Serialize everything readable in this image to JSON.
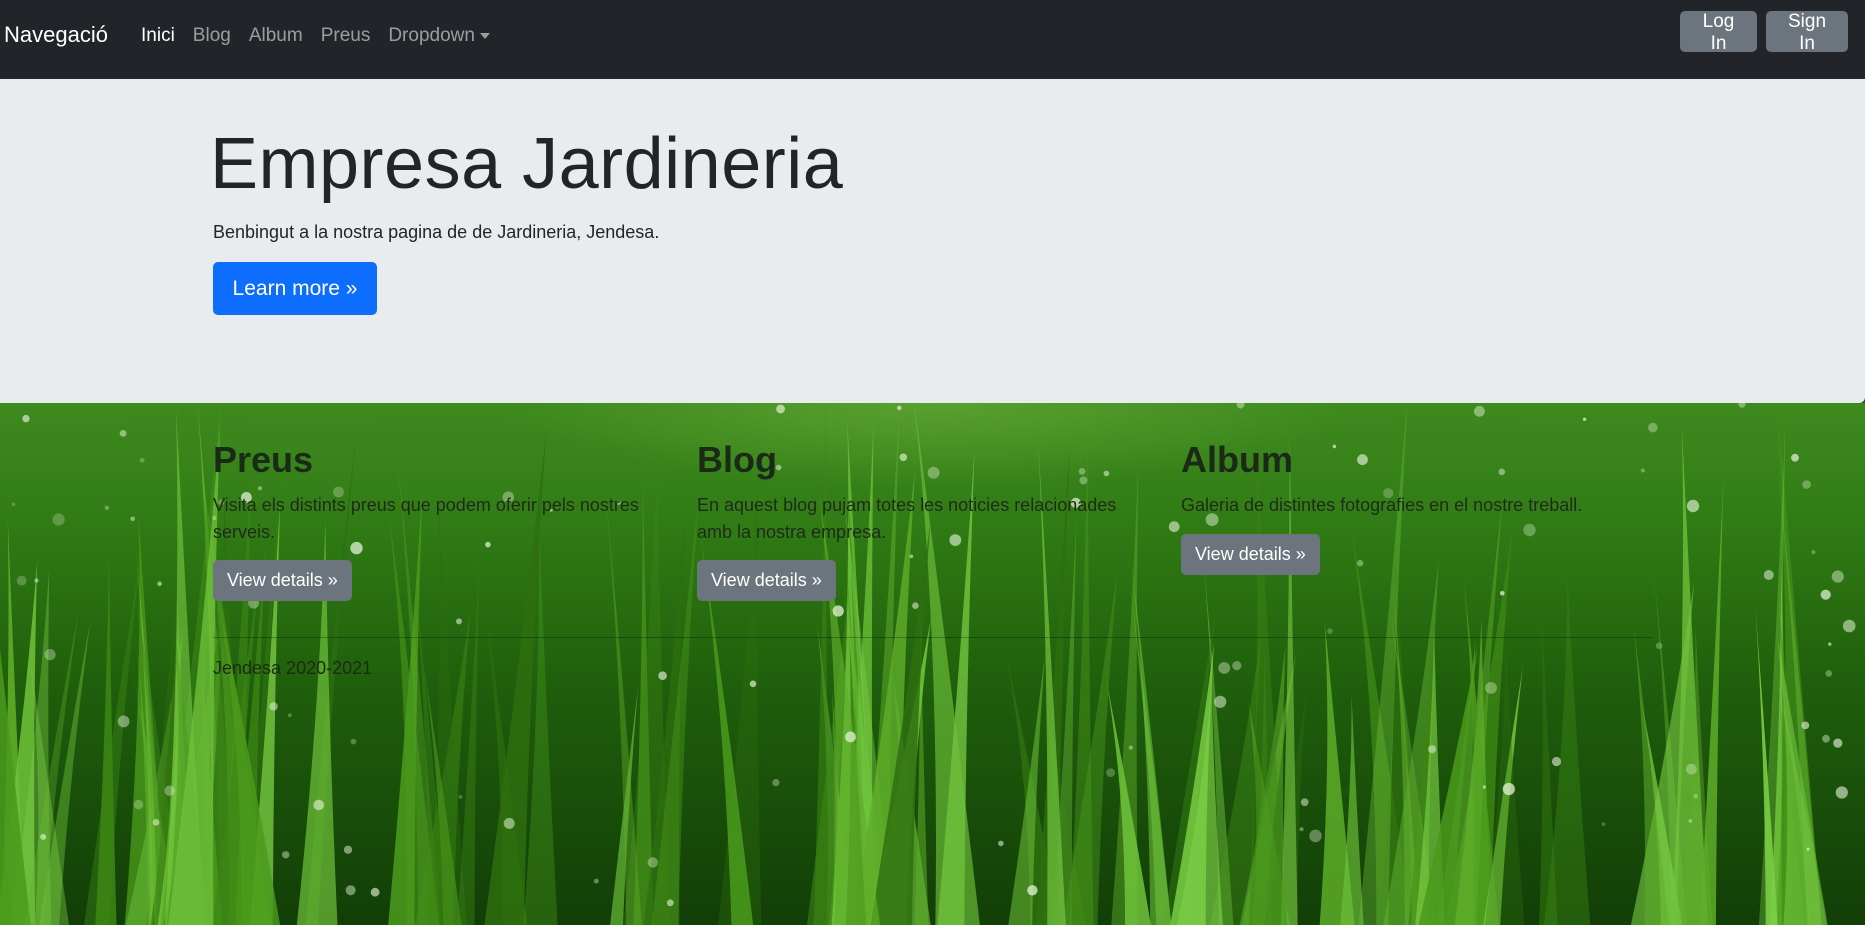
{
  "navbar": {
    "brand": "Navegació",
    "links": [
      {
        "label": "Inici",
        "active": true
      },
      {
        "label": "Blog",
        "active": false
      },
      {
        "label": "Album",
        "active": false
      },
      {
        "label": "Preus",
        "active": false
      },
      {
        "label": "Dropdown",
        "active": false
      }
    ],
    "login_label": "Log In",
    "signin_label": "Sign In"
  },
  "jumbotron": {
    "title": "Empresa Jardineria",
    "lead": "Benbingut a la nostra pagina de de Jardineria, Jendesa.",
    "button_label": "Learn more »"
  },
  "columns": [
    {
      "heading": "Preus",
      "text": "Visita els distints preus que podem oferir pels nostres serveis.",
      "button_label": "View details »"
    },
    {
      "heading": "Blog",
      "text": "En aquest blog pujam totes les noticies relacionades amb la nostra empresa.",
      "button_label": "View details »"
    },
    {
      "heading": "Album",
      "text": "Galeria de distintes fotografies en el nostre treball.",
      "button_label": "View details »"
    }
  ],
  "footer": {
    "text": "Jendesa 2020-2021"
  },
  "colors": {
    "navbar": "#212529",
    "jumbotron": "#e9ecef",
    "primary": "#0d6efd",
    "secondary": "#6c757d",
    "grass": "#2f7a14"
  }
}
